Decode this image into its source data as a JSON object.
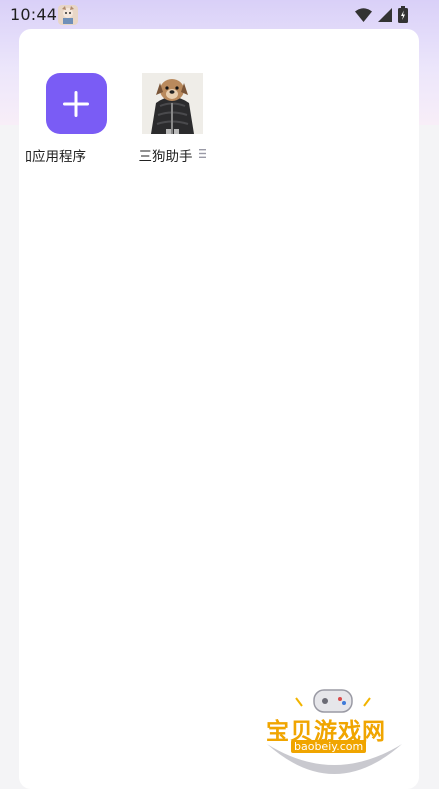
{
  "status_bar": {
    "time": "10:44",
    "icons": [
      "wifi-icon",
      "signal-icon",
      "battery-icon"
    ]
  },
  "apps": [
    {
      "label": "添加应用程序",
      "icon": "plus-icon",
      "icon_bg": "#7a5cf5"
    },
    {
      "label": "三狗助手",
      "icon": "dog-photo",
      "has_menu": true
    }
  ],
  "watermark": {
    "cn": "宝贝游戏网",
    "domain": "baobeiy.com"
  },
  "colors": {
    "accent": "#7a5cf5",
    "header_gradient_top": "#d9d0f8"
  }
}
